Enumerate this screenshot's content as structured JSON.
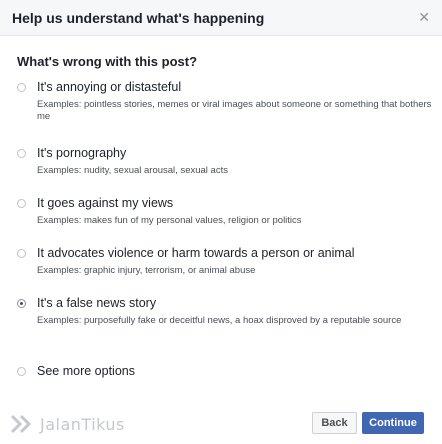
{
  "dialog": {
    "title": "Help us understand what's happening",
    "close_icon": "close-icon"
  },
  "question": "What's wrong with this post?",
  "options": [
    {
      "title": "It's annoying or distasteful",
      "description": "Examples: pointless stories, memes or viral images about someone or something that bothers me",
      "selected": false
    },
    {
      "title": "It's pornography",
      "description": "Examples: nudity, sexual arousal, sexual acts",
      "selected": false
    },
    {
      "title": "It goes against my views",
      "description": "Examples: makes fun of my personal values, religion or politics",
      "selected": false
    },
    {
      "title": "It advocates violence or harm towards a person or animal",
      "description": "Examples: graphic injury, terrorism, or animal abuse",
      "selected": false
    },
    {
      "title": "It's a false news story",
      "description": "Examples: purposefully fake or deceitful news, a hoax disproved by a reputable source",
      "selected": true
    },
    {
      "title": "See more options",
      "description": "",
      "selected": false
    }
  ],
  "footer": {
    "watermark": "JalanTikus",
    "back_label": "Back",
    "continue_label": "Continue"
  },
  "colors": {
    "header_bg": "#f6f7f9",
    "primary_button": "#4267b2",
    "text": "#1d2129",
    "secondary_text": "#4b4f56"
  }
}
